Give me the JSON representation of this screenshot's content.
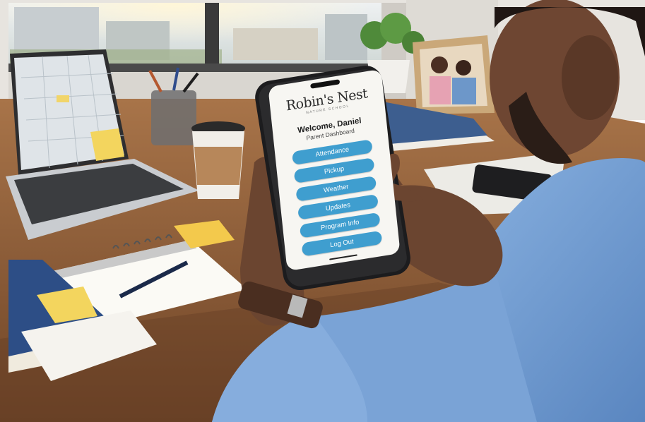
{
  "phone_app": {
    "brand_name": "Robin's Nest",
    "brand_tagline": "NATURE SCHOOL",
    "welcome_text": "Welcome, Daniel",
    "subtitle": "Parent Dashboard",
    "menu": [
      {
        "label": "Attendance"
      },
      {
        "label": "Pickup"
      },
      {
        "label": "Weather"
      },
      {
        "label": "Updates"
      },
      {
        "label": "Program Info"
      },
      {
        "label": "Log Out"
      }
    ],
    "accent_color": "#3f9ecf"
  },
  "scene_colors": {
    "desk": "#8a5a35",
    "shirt": "#6f9bd1",
    "skin": "#6b4530",
    "window_light": "#f4ead0"
  }
}
